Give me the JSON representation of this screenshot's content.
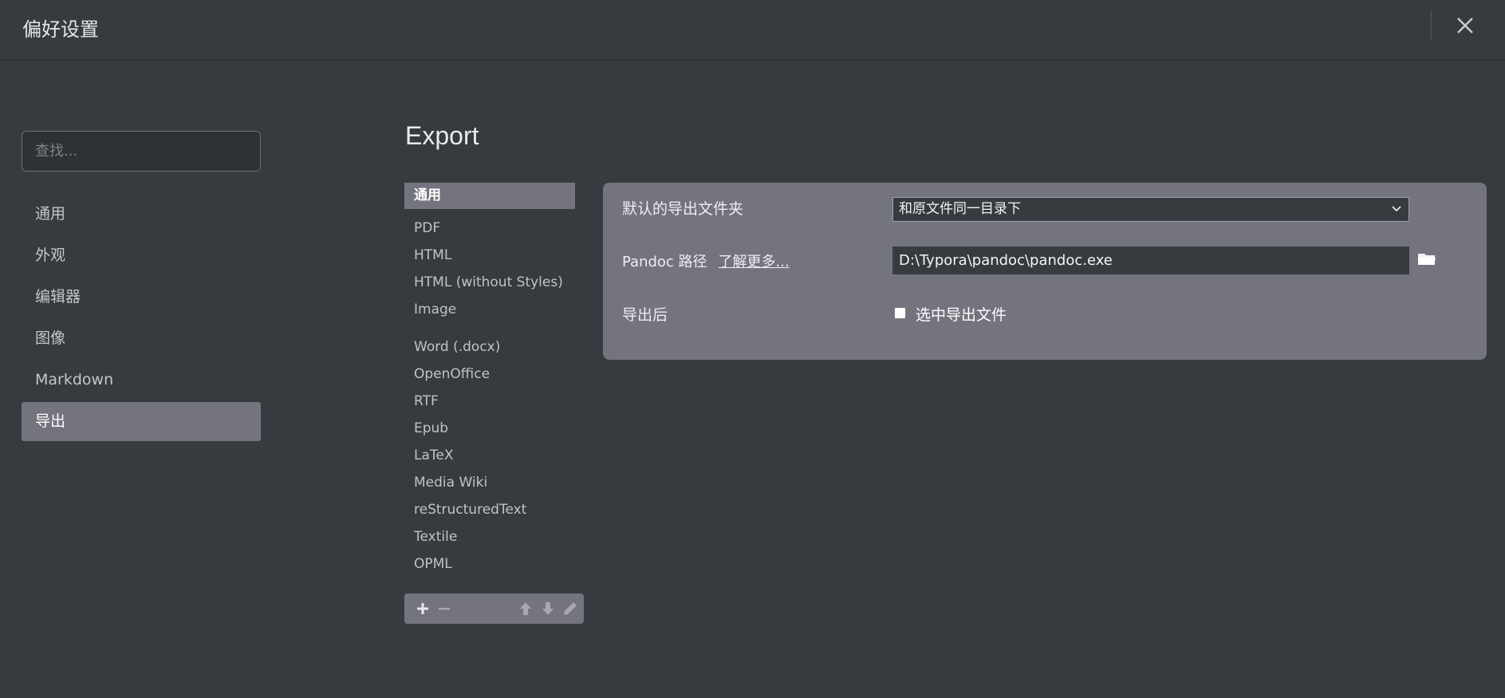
{
  "window": {
    "title": "偏好设置"
  },
  "search": {
    "placeholder": "查找..."
  },
  "sidebar": {
    "items": [
      {
        "label": "通用"
      },
      {
        "label": "外观"
      },
      {
        "label": "编辑器"
      },
      {
        "label": "图像"
      },
      {
        "label": "Markdown"
      },
      {
        "label": "导出",
        "active": true
      }
    ]
  },
  "main": {
    "title": "Export"
  },
  "formats": {
    "items": [
      "通用",
      "PDF",
      "HTML",
      "HTML (without Styles)",
      "Image",
      "Word (.docx)",
      "OpenOffice",
      "RTF",
      "Epub",
      "LaTeX",
      "Media Wiki",
      "reStructuredText",
      "Textile",
      "OPML"
    ],
    "selected": "通用"
  },
  "settings": {
    "default_folder_label": "默认的导出文件夹",
    "default_folder_value": "和原文件同一目录下",
    "pandoc_label": "Pandoc 路径",
    "pandoc_learn_more": "了解更多...",
    "pandoc_path": "D:\\Typora\\pandoc\\pandoc.exe",
    "after_export_label": "导出后",
    "select_file_label": "选中导出文件",
    "select_file_checked": false
  },
  "colors": {
    "background": "#363b40",
    "active_item": "#74747f",
    "panel": "#74747f"
  },
  "icons": {
    "close": "close-icon",
    "chevron": "chevron-down-icon",
    "folder": "folder-icon",
    "add": "plus-icon",
    "remove": "minus-icon",
    "up": "arrow-up-icon",
    "down": "arrow-down-icon",
    "edit": "pencil-icon"
  }
}
